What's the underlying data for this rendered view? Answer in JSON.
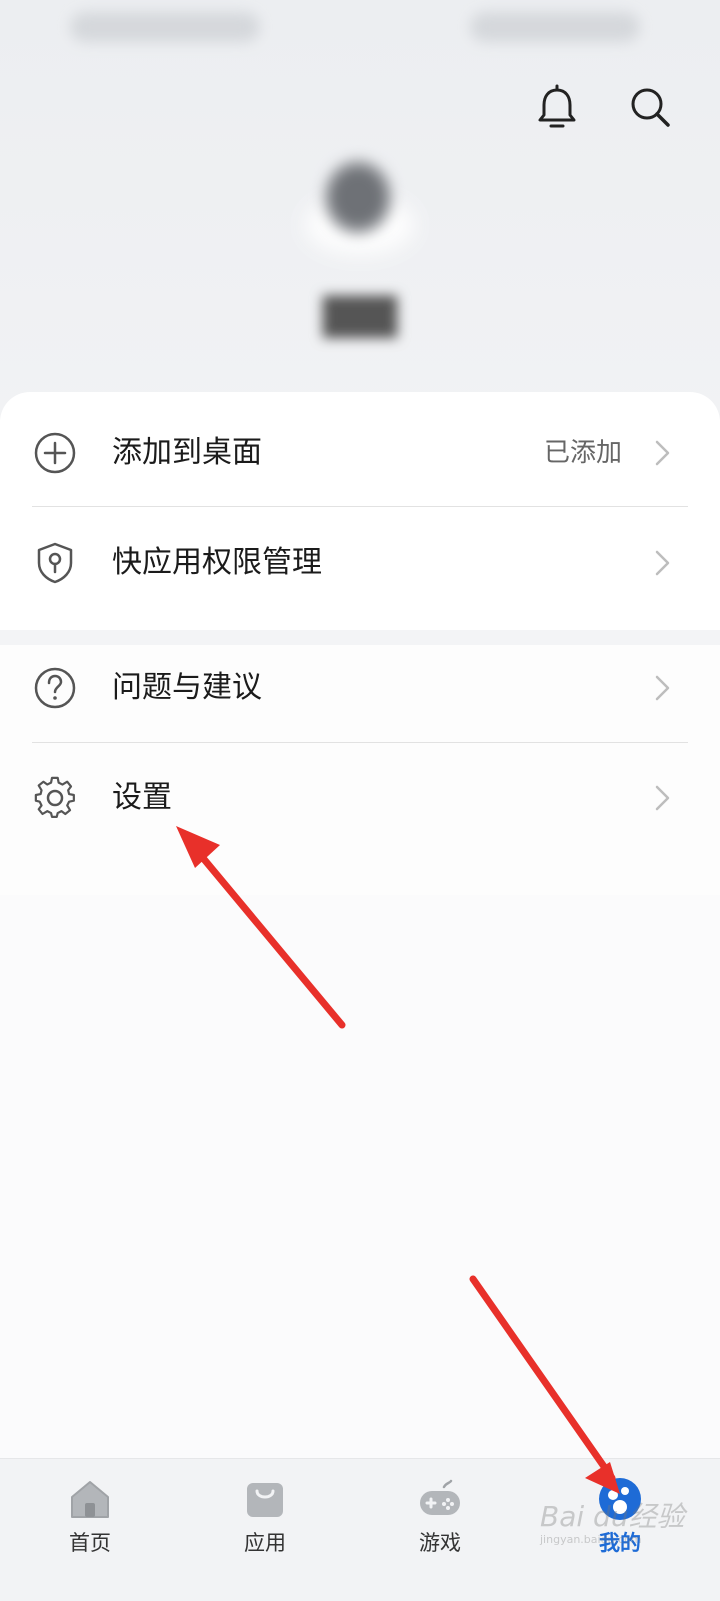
{
  "menu_group_1": [
    {
      "icon": "add-circle-icon",
      "label": "添加到桌面",
      "value": "已添加"
    },
    {
      "icon": "shield-key-icon",
      "label": "快应用权限管理",
      "value": ""
    }
  ],
  "menu_group_2": [
    {
      "icon": "question-circle-icon",
      "label": "问题与建议",
      "value": ""
    },
    {
      "icon": "gear-icon",
      "label": "设置",
      "value": ""
    }
  ],
  "bottom_nav": [
    {
      "icon": "home-icon",
      "label": "首页",
      "active": false
    },
    {
      "icon": "shopping-bag-icon",
      "label": "应用",
      "active": false
    },
    {
      "icon": "gamepad-icon",
      "label": "游戏",
      "active": false
    },
    {
      "icon": "profile-icon",
      "label": "我的",
      "active": true
    }
  ],
  "watermark": {
    "text": "Bai du经验",
    "sub": "jingyan.baidu.com"
  },
  "colors": {
    "accent": "#1e6bd6",
    "annotation_arrow": "#e8302a"
  }
}
